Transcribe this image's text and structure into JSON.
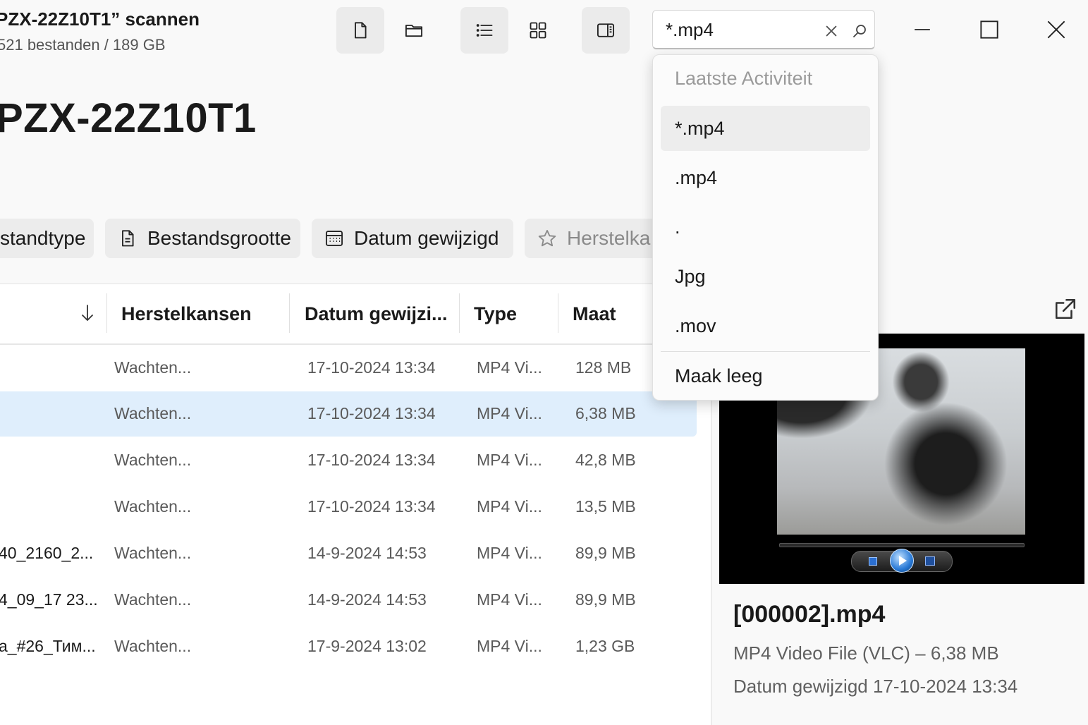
{
  "header": {
    "title": "PZX-22Z10T1” scannen",
    "subtitle": "521 bestanden / 189 GB",
    "drive_name": "PZX-22Z10T1"
  },
  "toolbar": {
    "buttons": [
      {
        "icon": "file-icon",
        "active": true
      },
      {
        "icon": "folder-icon",
        "active": false
      },
      {
        "icon": "list-view-icon",
        "active": true
      },
      {
        "icon": "grid-view-icon",
        "active": false
      },
      {
        "icon": "preview-pane-icon",
        "active": true
      }
    ]
  },
  "search": {
    "value": "*.mp4",
    "clear_icon": "close-icon",
    "search_icon": "search-icon"
  },
  "window_controls": [
    "minimize-icon",
    "maximize-icon",
    "close-icon"
  ],
  "filters": [
    {
      "label": "standtype",
      "icon": ""
    },
    {
      "label": "Bestandsgrootte",
      "icon": "document-icon"
    },
    {
      "label": "Datum gewijzigd",
      "icon": "calendar-icon"
    },
    {
      "label": "Herstelka",
      "icon": "star-icon"
    }
  ],
  "table": {
    "sort_icon": "arrow-down-icon",
    "columns": [
      "Herstelkansen",
      "Datum gewijzi...",
      "Type",
      "Maat"
    ],
    "rows": [
      {
        "name": "",
        "chance": "Wachten...",
        "date": "17-10-2024 13:34",
        "type": "MP4 Vi...",
        "size": "128 MB",
        "selected": false
      },
      {
        "name": "",
        "chance": "Wachten...",
        "date": "17-10-2024 13:34",
        "type": "MP4 Vi...",
        "size": "6,38 MB",
        "selected": true
      },
      {
        "name": "",
        "chance": "Wachten...",
        "date": "17-10-2024 13:34",
        "type": "MP4 Vi...",
        "size": "42,8 MB",
        "selected": false
      },
      {
        "name": "",
        "chance": "Wachten...",
        "date": "17-10-2024 13:34",
        "type": "MP4 Vi...",
        "size": "13,5 MB",
        "selected": false
      },
      {
        "name": "40_2160_2...",
        "chance": "Wachten...",
        "date": "14-9-2024 14:53",
        "type": "MP4 Vi...",
        "size": "89,9 MB",
        "selected": false
      },
      {
        "name": "4_09_17 23...",
        "chance": "Wachten...",
        "date": "14-9-2024 14:53",
        "type": "MP4 Vi...",
        "size": "89,9 MB",
        "selected": false
      },
      {
        "name": "a_#26_Тим...",
        "chance": "Wachten...",
        "date": "17-9-2024 13:02",
        "type": "MP4 Vi...",
        "size": "1,23 GB",
        "selected": false
      }
    ]
  },
  "preview": {
    "file_name": "[000002].mp4",
    "file_type": "MP4 Video File (VLC) – 6,38 MB",
    "date_modified": "Datum gewijzigd 17-10-2024 13:34",
    "open_icon": "open-external-icon"
  },
  "search_dropdown": {
    "header": "Laatste Activiteit",
    "items": [
      "*.mp4",
      ".mp4",
      ".",
      "Jpg",
      ".mov"
    ],
    "highlighted_index": 0,
    "clear_label": "Maak leeg"
  }
}
